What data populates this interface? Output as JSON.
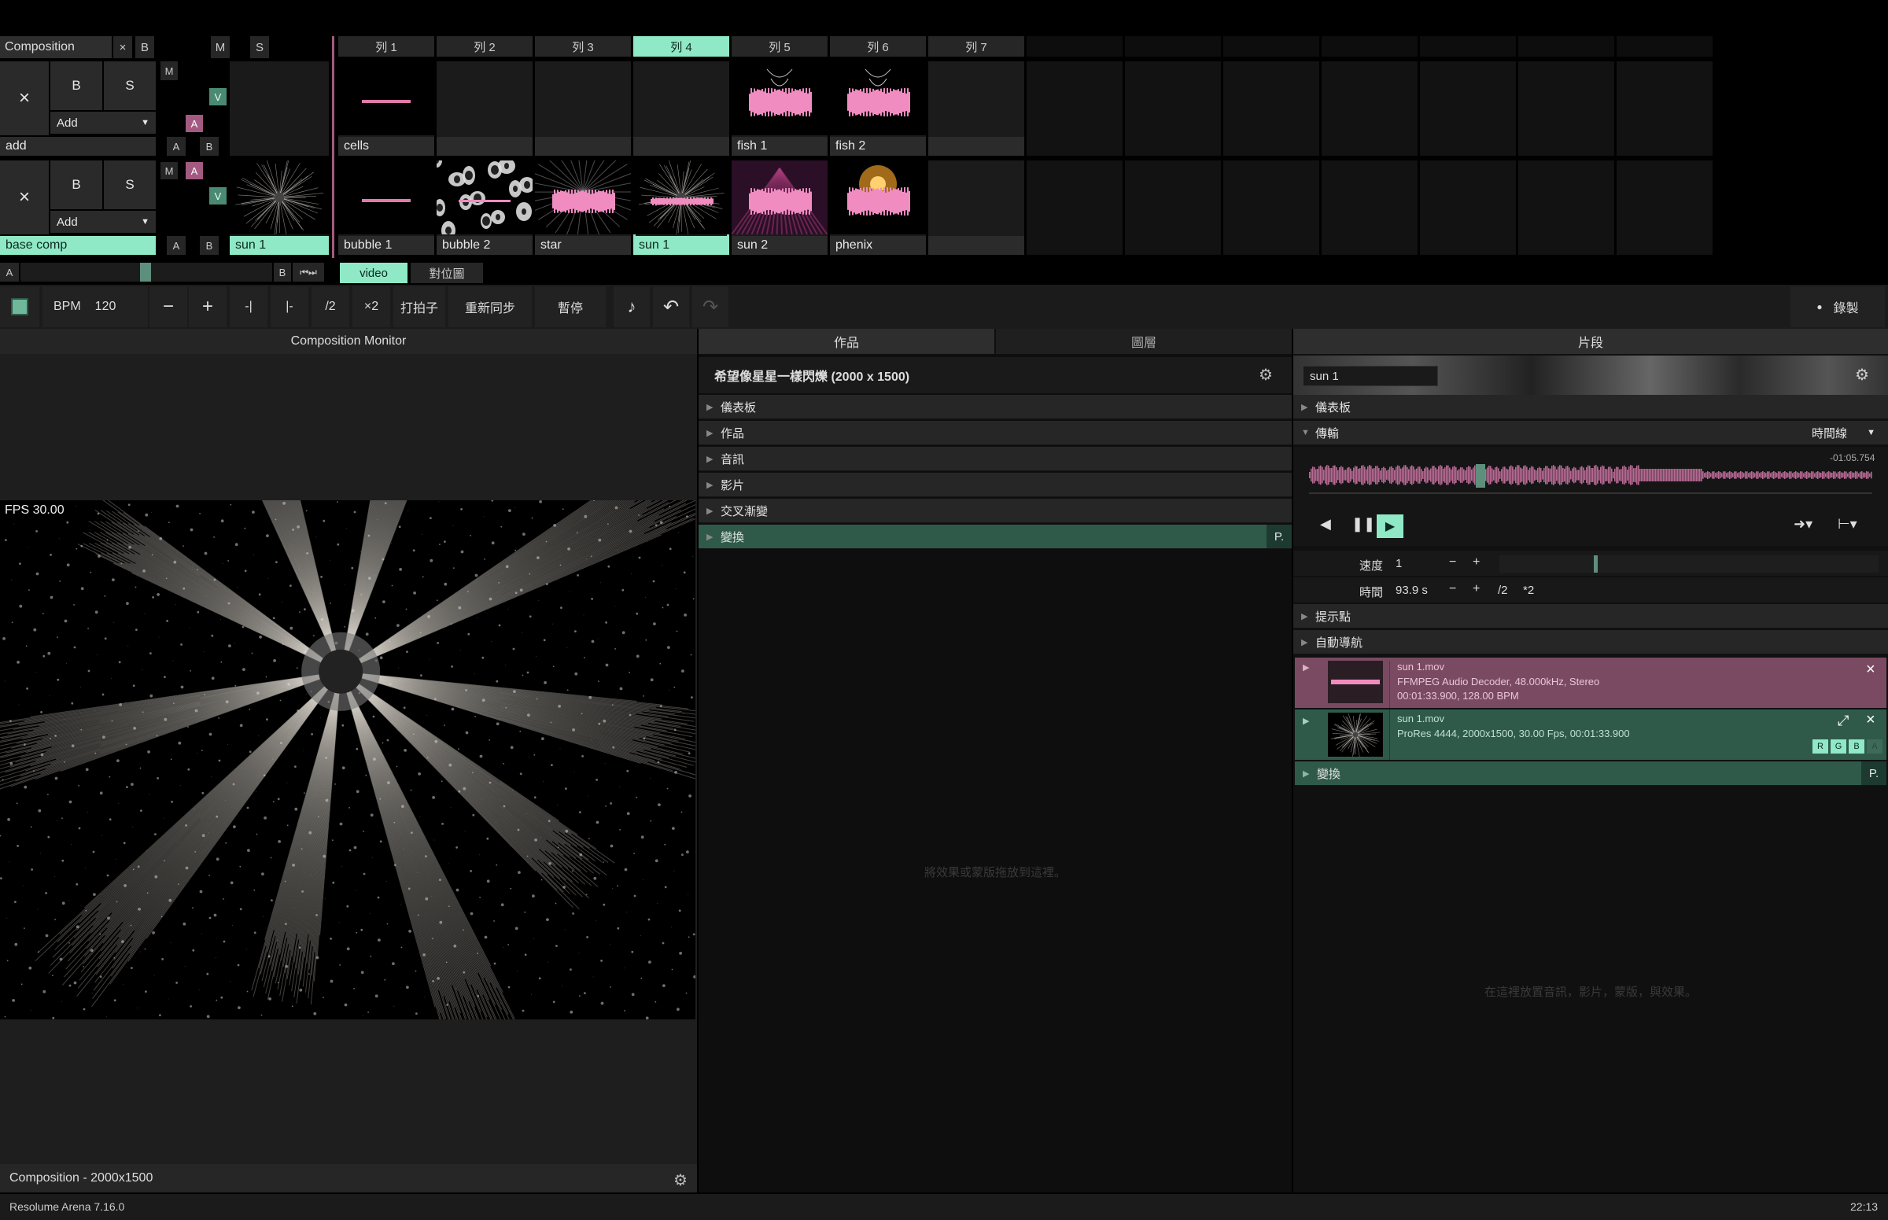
{
  "deck": {
    "comp_label": "Composition",
    "x": "×",
    "b": "B",
    "m": "M",
    "s": "S",
    "columns": [
      "列 1",
      "列 2",
      "列 3",
      "列 4",
      "列 5",
      "列 6",
      "列 7"
    ],
    "active_column": 3
  },
  "layers": [
    {
      "close": "×",
      "b": "B",
      "s": "S",
      "blend": "Add",
      "m": "M",
      "v": "V",
      "a": "A",
      "name": "add",
      "ab_a": "A",
      "ab_b": "B",
      "clips": [
        "cells",
        "",
        "",
        "",
        "fish 1",
        "fish 2",
        ""
      ]
    },
    {
      "close": "×",
      "b": "B",
      "s": "S",
      "blend": "Add",
      "m": "M",
      "v": "V",
      "a": "A",
      "name": "base comp",
      "ab_a": "A",
      "ab_b": "B",
      "preview": "sun 1",
      "clips": [
        "bubble 1",
        "bubble 2",
        "star",
        "sun 1",
        "sun 2",
        "phenix",
        ""
      ]
    }
  ],
  "crossfader": {
    "a": "A",
    "b": "B"
  },
  "deck_tabs": [
    "video",
    "對位圖"
  ],
  "transport": {
    "bpm_label": "BPM",
    "bpm": "120",
    "minus": "−",
    "plus": "+",
    "half": "/2",
    "double": "×2",
    "tap": "打拍子",
    "resync": "重新同步",
    "pause": "暫停",
    "record": "錄製"
  },
  "monitor": {
    "title": "Composition Monitor",
    "fps": "FPS 30.00",
    "footer": "Composition - 2000x1500"
  },
  "comp_panel": {
    "tabs": [
      "作品",
      "圖層"
    ],
    "title": "希望像星星一樣閃爍 (2000 x 1500)",
    "rows": [
      "儀表板",
      "作品",
      "音訊",
      "影片",
      "交叉漸變",
      "變換"
    ],
    "p": "P.",
    "drop_hint": "將效果或蒙版拖放到這裡。"
  },
  "clip_panel": {
    "title": "片段",
    "name": "sun 1",
    "rows_top": [
      "儀表板",
      "傳輸"
    ],
    "timeline_label": "時間線",
    "remaining": "-01:05.754",
    "speed_label": "速度",
    "speed": "1",
    "time_label": "時間",
    "time": "93.9 s",
    "half": "/2",
    "double": "*2",
    "minus": "−",
    "plus": "+",
    "rows_mid": [
      "提示點",
      "自動導航"
    ],
    "audio": {
      "file": "sun 1.mov",
      "line1": "FFMPEG Audio Decoder, 48.000kHz, Stereo",
      "line2": "00:01:33.900, 128.00 BPM"
    },
    "video": {
      "file": "sun 1.mov",
      "line1": "ProRes 4444, 2000x1500, 30.00 Fps, 00:01:33.900",
      "rgb": [
        "R",
        "G",
        "B",
        "A"
      ]
    },
    "transform": "變換",
    "p": "P.",
    "drop_hint": "在這裡放置音訊，影片，蒙版，與效果。"
  },
  "status": {
    "app": "Resolume Arena 7.16.0",
    "time": "22:13"
  },
  "colors": {
    "accent": "#8fe8c6",
    "pink": "#a25a80",
    "green": "#2f5a4a"
  }
}
